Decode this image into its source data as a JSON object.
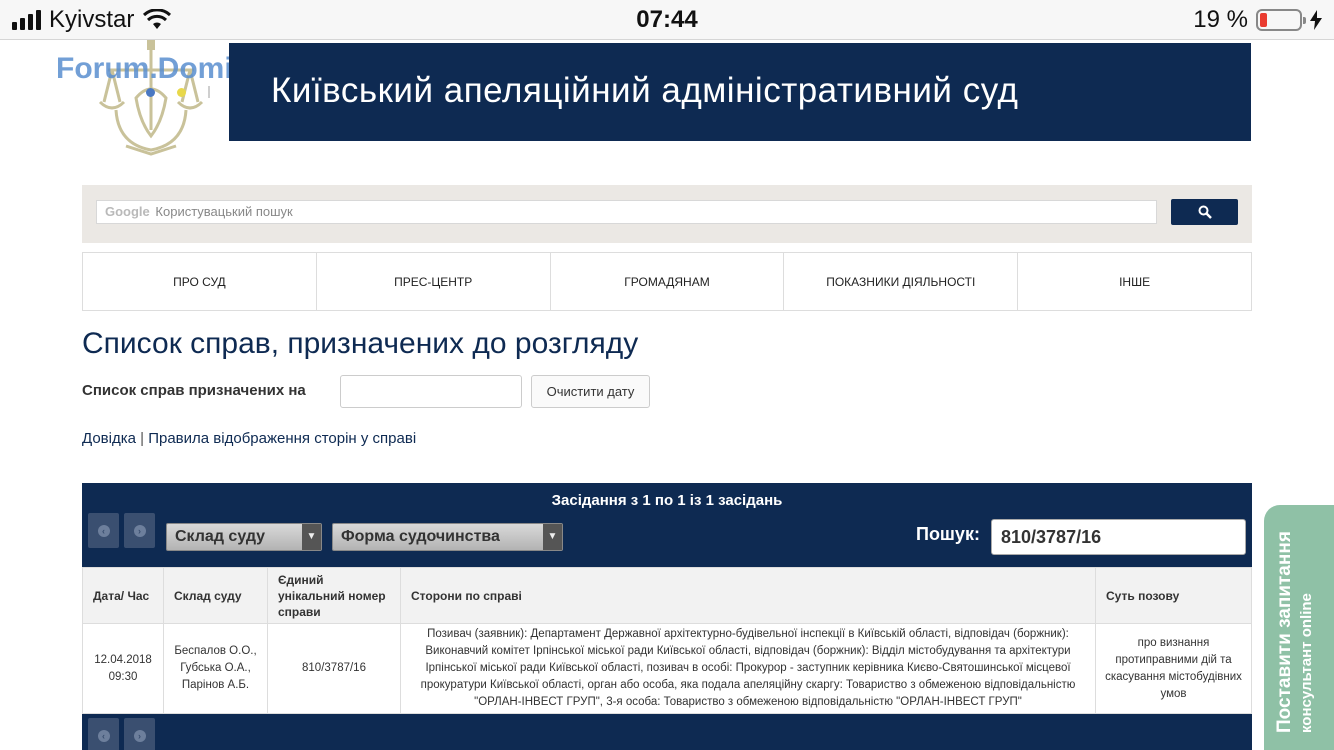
{
  "status_bar": {
    "carrier": "Kyivstar",
    "time": "07:44",
    "battery": "19 %",
    "battery_level": 0.19
  },
  "header": {
    "watermark": "Forum.Domik.ua",
    "title": "Київський апеляційний адміністративний суд"
  },
  "search": {
    "google_label": "Google",
    "placeholder": "Користувацький пошук"
  },
  "nav": {
    "items": [
      "ПРО СУД",
      "ПРЕС-ЦЕНТР",
      "ГРОМАДЯНАМ",
      "ПОКАЗНИКИ ДІЯЛЬНОСТІ",
      "ІНШЕ"
    ]
  },
  "page": {
    "title": "Список справ, призначених до розгляду",
    "date_label": "Список справ призначених на",
    "date_value": "",
    "clear_button": "Очистити дату",
    "link_help": "Довідка",
    "link_separator": "|",
    "link_rules": "Правила відображення сторін у справі"
  },
  "table_panel": {
    "caption": "Засідання з 1 по 1 із 1 засідань",
    "select_court": "Склад суду",
    "select_form": "Форма судочинства",
    "search_label": "Пошук:",
    "search_value": "810/3787/16",
    "columns": [
      "Дата/ Час",
      "Склад суду",
      "Єдиний унікальний номер справи",
      "Сторони по справі",
      "Суть позову"
    ],
    "rows": [
      {
        "date": "12.04.2018 09:30",
        "judges": "Беспалов О.О., Губська О.А., Парінов А.Б.",
        "case_number": "810/3787/16",
        "parties": "Позивач (заявник): Департамент Державної архітектурно-будівельної інспекції в Київській області, відповідач (боржник): Виконавчий комітет Ірпінської міської ради Київської області, відповідач (боржник): Відділ містобудування та архітектури Ірпінської міської ради Київської області, позивач в особі: Прокурор - заступник керівника Києво-Святошинської місцевої прокуратури Київської області, орган або особа, яка подала апеляційну скаргу: Товариство з обмеженою відповідальністю \"ОРЛАН-ІНВЕСТ ГРУП\", 3-я особа: Товариство з обмеженою відповідальністю \"ОРЛАН-ІНВЕСТ ГРУП\"",
        "claim": "про визнання протиправними дій та скасування містобудівних умов"
      }
    ]
  },
  "floating_tab": {
    "line1": "Поставити запитання",
    "line2": "консультант online"
  },
  "colors": {
    "brand_navy": "#0e2a52",
    "floating_tab": "#8fc1a6",
    "battery_low": "#ea3b30"
  }
}
